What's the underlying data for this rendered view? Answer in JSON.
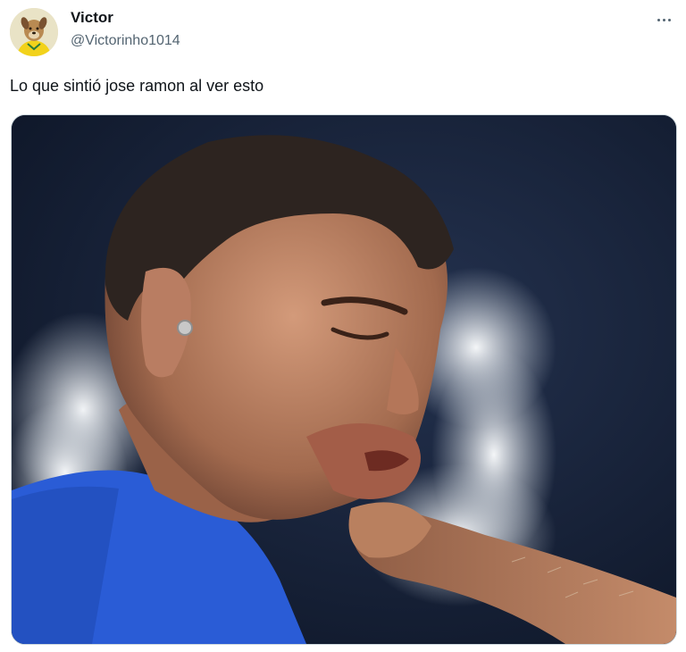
{
  "tweet": {
    "author": {
      "display_name": "Victor",
      "handle": "@Victorinho1014",
      "avatar_icon": "dog-avatar"
    },
    "more_icon": "more-horizontal-icon",
    "text": "Lo que sintió jose ramon al ver esto",
    "media": {
      "kind": "photo",
      "alt_icon": "punch-photo"
    }
  },
  "colors": {
    "text_primary": "#0f1419",
    "text_secondary": "#536471",
    "border": "#cfd9de",
    "photo_background": "#14203a",
    "jersey_blue": "#2a5cd6"
  }
}
